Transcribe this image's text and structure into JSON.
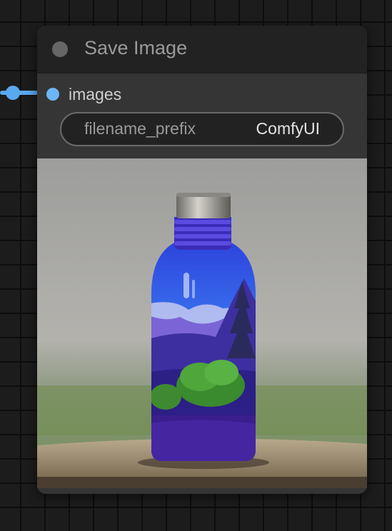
{
  "node": {
    "title": "Save Image",
    "input": {
      "label": "images",
      "color": "#6cb6f4"
    },
    "widget": {
      "name": "filename_prefix",
      "value": "ComfyUI"
    }
  },
  "colors": {
    "canvas": "#1c1c1c",
    "node_body": "#353535",
    "node_header": "#222222",
    "link": "#5aa8ee"
  },
  "preview": {
    "icon": "generated-image-thumbnail"
  }
}
